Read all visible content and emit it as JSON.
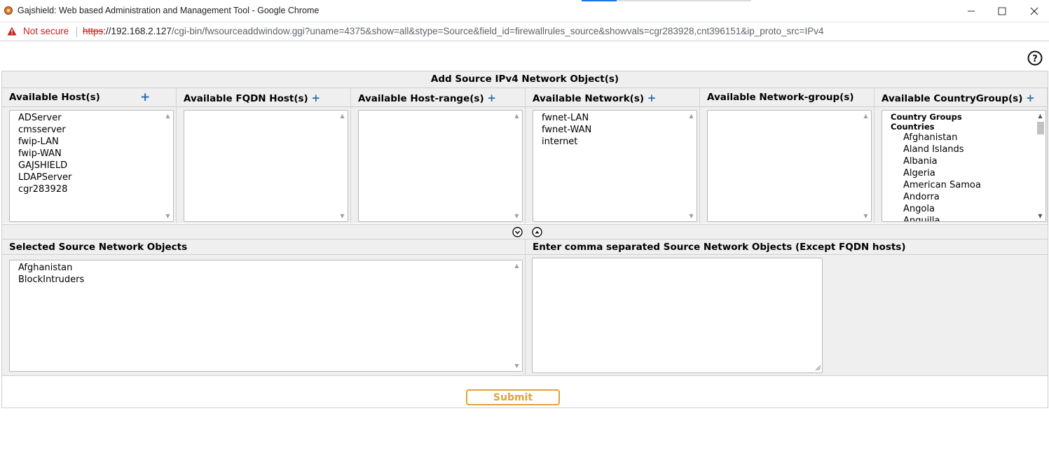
{
  "window": {
    "title": "Gajshield: Web based Administration and Management Tool - Google Chrome"
  },
  "address_bar": {
    "security_label": "Not secure",
    "url_scheme": "https",
    "url_host": "://192.168.2.127",
    "url_path": "/cgi-bin/fwsourceaddwindow.ggi?uname=4375&show=all&stype=Source&field_id=firewallrules_source&showvals=cgr283928,cnt396151&ip_proto_src=IPv4"
  },
  "panel": {
    "title": "Add Source IPv4 Network Object(s)",
    "columns": [
      {
        "label": "Available Host(s)",
        "has_add": true,
        "items": [
          "ADServer",
          "cmsserver",
          "fwip-LAN",
          "fwip-WAN",
          "GAJSHIELD",
          "LDAPServer",
          "cgr283928"
        ]
      },
      {
        "label": "Available FQDN Host(s)",
        "has_add": true,
        "items": []
      },
      {
        "label": "Available Host-range(s)",
        "has_add": true,
        "items": []
      },
      {
        "label": "Available Network(s)",
        "has_add": true,
        "items": [
          "fwnet-LAN",
          "fwnet-WAN",
          "internet"
        ]
      },
      {
        "label": "Available Network-group(s)",
        "has_add": false,
        "items": []
      },
      {
        "label": "Available CountryGroup(s)",
        "has_add": true,
        "groups": [
          "Country Groups",
          "Countries"
        ],
        "countries": [
          "Afghanistan",
          "Aland Islands",
          "Albania",
          "Algeria",
          "American Samoa",
          "Andorra",
          "Angola",
          "Anguilla"
        ]
      }
    ],
    "add_symbol": "+",
    "selected_header": "Selected Source Network Objects",
    "manual_header": "Enter comma separated Source Network Objects (Except FQDN hosts)",
    "selected_items": [
      "Afghanistan",
      "BlockIntruders"
    ],
    "manual_value": "",
    "submit_label": "Submit"
  },
  "colors": {
    "submit_accent": "#e0a23b",
    "add_plus": "#2b6cb0",
    "not_secure": "#c5221f"
  }
}
